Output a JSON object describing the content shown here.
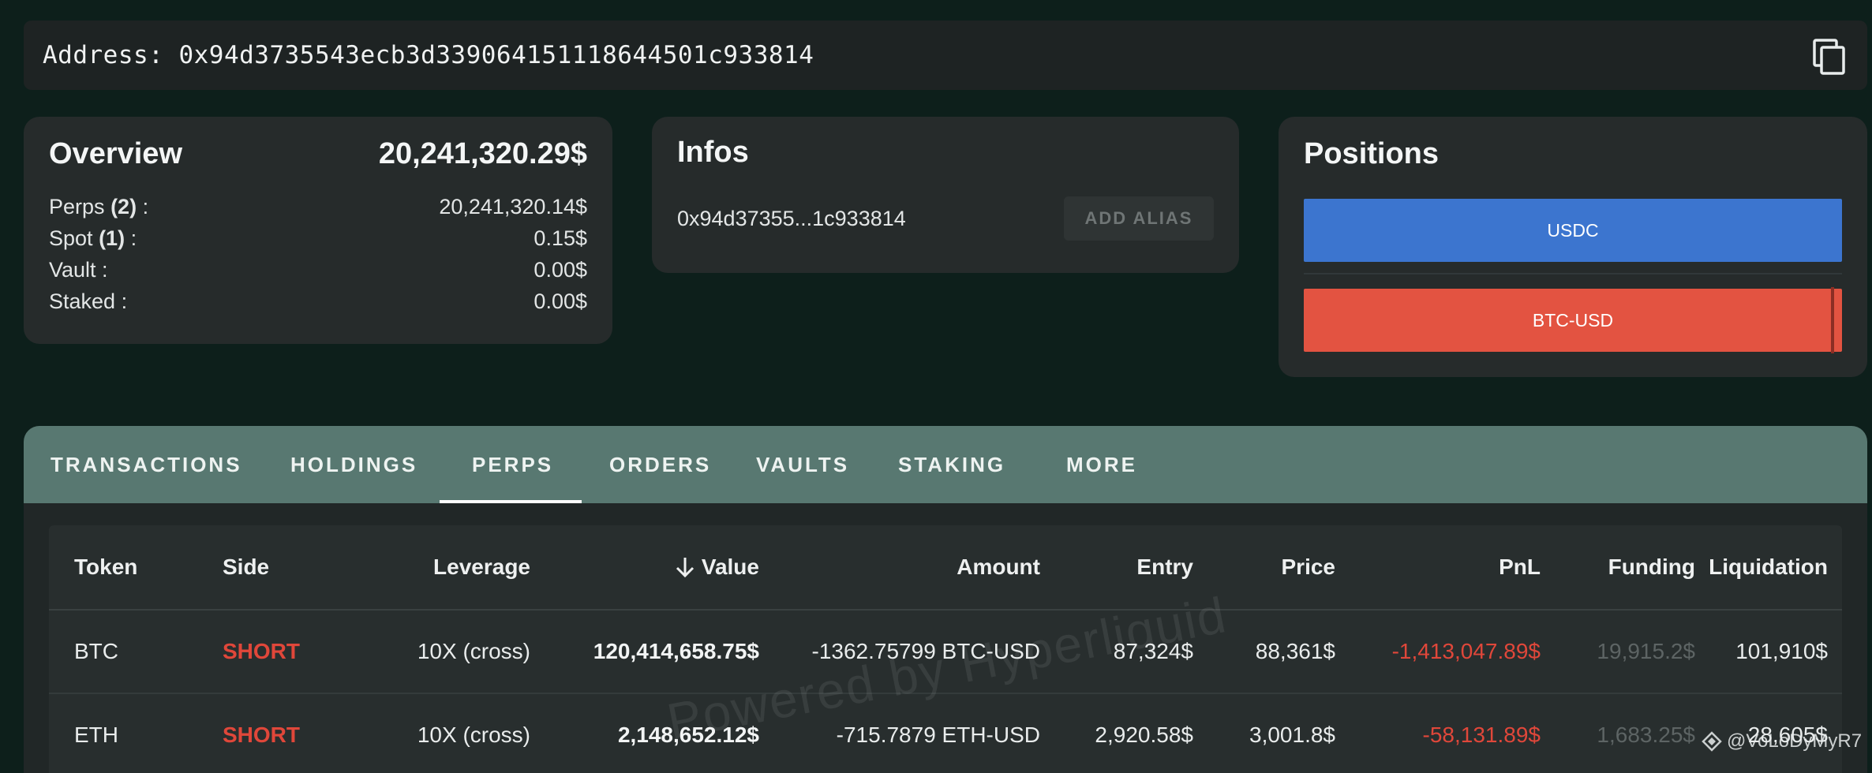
{
  "address_bar": {
    "label": "Address:",
    "address": "0x94d3735543ecb3d339064151118644501c933814"
  },
  "overview": {
    "title": "Overview",
    "total": "20,241,320.29$",
    "rows": [
      {
        "label": "Perps",
        "count": "(2)",
        "value": "20,241,320.14$"
      },
      {
        "label": "Spot",
        "count": "(1)",
        "value": "0.15$"
      },
      {
        "label": "Vault",
        "count": "",
        "value": "0.00$"
      },
      {
        "label": "Staked",
        "count": "",
        "value": "0.00$"
      }
    ]
  },
  "infos": {
    "title": "Infos",
    "short_address": "0x94d37355...1c933814",
    "add_alias_label": "ADD ALIAS"
  },
  "positions": {
    "title": "Positions",
    "bars": [
      {
        "label": "USDC",
        "color": "#3c75cf"
      },
      {
        "label": "BTC-USD",
        "color": "#e35341"
      }
    ]
  },
  "tabs": [
    "TRANSACTIONS",
    "HOLDINGS",
    "PERPS",
    "ORDERS",
    "VAULTS",
    "STAKING",
    "MORE"
  ],
  "active_tab": "PERPS",
  "table": {
    "headers": [
      "Token",
      "Side",
      "Leverage",
      "Value",
      "Amount",
      "Entry",
      "Price",
      "PnL",
      "Funding",
      "Liquidation"
    ],
    "sort_column": "Value",
    "sort_direction": "descending",
    "rows": [
      {
        "token": "BTC",
        "side": "SHORT",
        "leverage": "10X (cross)",
        "value": "120,414,658.75$",
        "amount": "-1362.75799 BTC-USD",
        "entry": "87,324$",
        "price": "88,361$",
        "pnl": "-1,413,047.89$",
        "funding": "19,915.2$",
        "liquidation": "101,910$"
      },
      {
        "token": "ETH",
        "side": "SHORT",
        "leverage": "10X (cross)",
        "value": "2,148,652.12$",
        "amount": "-715.7879 ETH-USD",
        "entry": "2,920.58$",
        "price": "3,001.8$",
        "pnl": "-58,131.89$",
        "funding": "1,683.25$",
        "liquidation": "28,605$"
      }
    ]
  },
  "watermark": "Powered by Hyperliquid",
  "signature": "@VoLoDyMyR7",
  "colors": {
    "background": "#0d1f1b",
    "card": "#262b2b",
    "tab_bar": "#587871",
    "negative": "#e0473a",
    "usdc": "#3c75cf",
    "btc": "#e35341"
  }
}
